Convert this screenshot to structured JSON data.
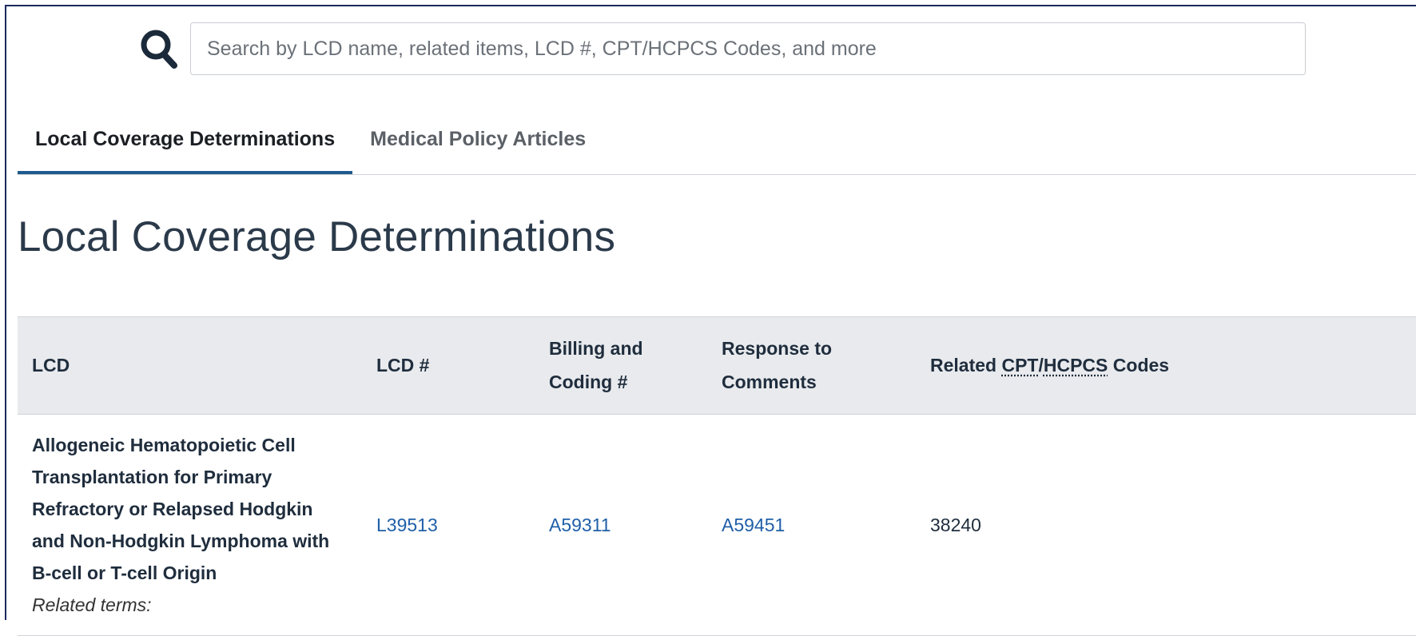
{
  "search": {
    "placeholder": "Search by LCD name, related items, LCD #, CPT/HCPCS Codes, and more"
  },
  "tabs": [
    {
      "label": "Local Coverage Determinations",
      "active": true
    },
    {
      "label": "Medical Policy Articles",
      "active": false
    }
  ],
  "page_title": "Local Coverage Determinations",
  "table": {
    "headers": {
      "lcd": "LCD",
      "lcd_num": "LCD #",
      "billing": "Billing and Coding #",
      "response": "Response to Comments",
      "related_prefix": "Related ",
      "related_cpt": "CPT",
      "related_slash": "/",
      "related_hcpcs": "HCPCS",
      "related_suffix": " Codes"
    },
    "rows": [
      {
        "lcd": "Allogeneic Hematopoietic Cell Transplantation for Primary Refractory or Relapsed Hodgkin and Non-Hodgkin Lymphoma with B-cell or T-cell Origin",
        "related_terms": "Related terms:",
        "lcd_num": "L39513",
        "billing": "A59311",
        "response": "A59451",
        "related_codes": "38240"
      }
    ]
  },
  "colors": {
    "link": "#1f5fa8",
    "tab_active_underline": "#1d5a8e",
    "header_bg": "#e8eaed"
  },
  "icons": {
    "search": "search-icon"
  }
}
